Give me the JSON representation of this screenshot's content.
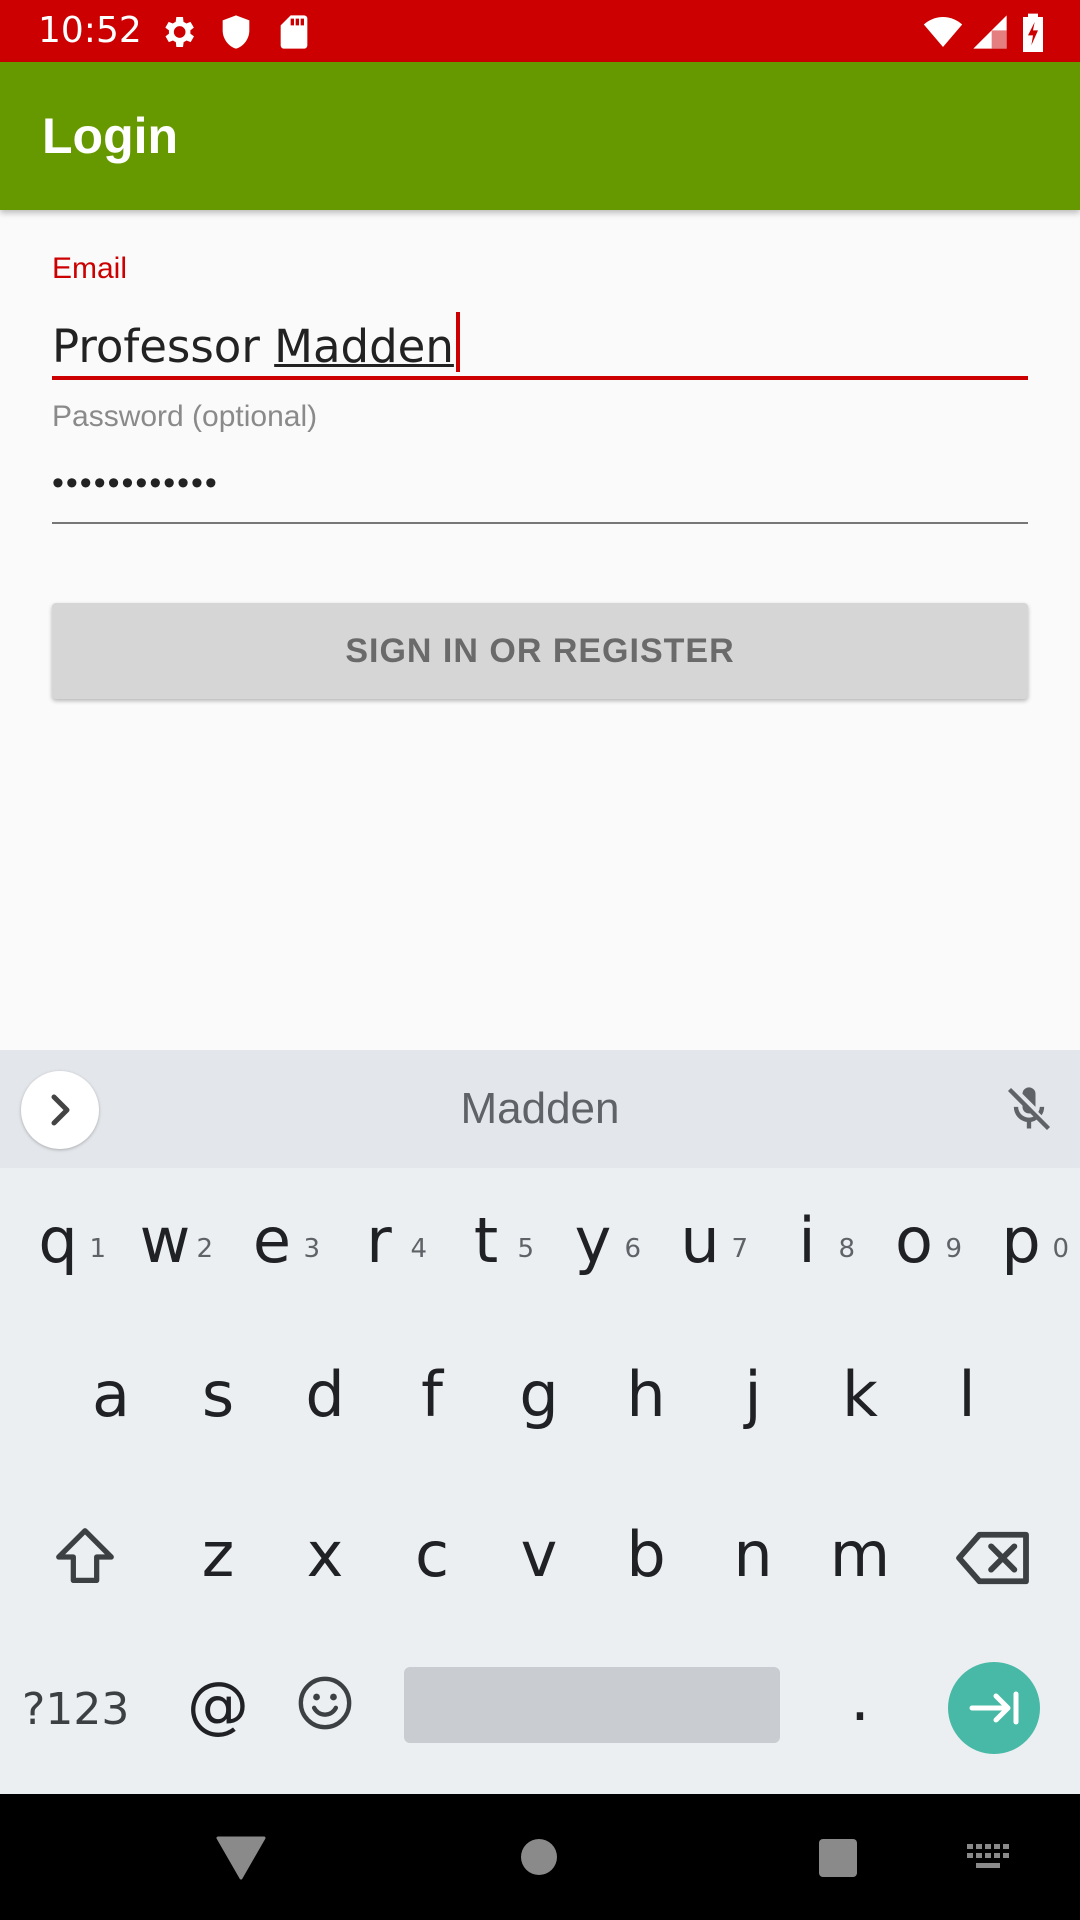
{
  "status_bar": {
    "time": "10:52",
    "left_icons": [
      "gear-icon",
      "shield-icon",
      "sd-card-icon"
    ],
    "right_icons": [
      "wifi-icon",
      "signal-icon",
      "battery-charging-icon"
    ]
  },
  "app_bar": {
    "title": "Login"
  },
  "form": {
    "email": {
      "label": "Email",
      "value_prefix": "Professor ",
      "value_composing": "Madden"
    },
    "password": {
      "label": "Password (optional)",
      "value": "••••••••••••"
    },
    "submit_label": "SIGN IN OR REGISTER"
  },
  "keyboard": {
    "suggestion": "Madden",
    "row1": [
      {
        "key": "q",
        "hint": "1"
      },
      {
        "key": "w",
        "hint": "2"
      },
      {
        "key": "e",
        "hint": "3"
      },
      {
        "key": "r",
        "hint": "4"
      },
      {
        "key": "t",
        "hint": "5"
      },
      {
        "key": "y",
        "hint": "6"
      },
      {
        "key": "u",
        "hint": "7"
      },
      {
        "key": "i",
        "hint": "8"
      },
      {
        "key": "o",
        "hint": "9"
      },
      {
        "key": "p",
        "hint": "0"
      }
    ],
    "row2": [
      "a",
      "s",
      "d",
      "f",
      "g",
      "h",
      "j",
      "k",
      "l"
    ],
    "row3": [
      "z",
      "x",
      "c",
      "v",
      "b",
      "n",
      "m"
    ],
    "symbols_label": "?123",
    "at_label": "@",
    "period_label": "."
  },
  "colors": {
    "status_bar": "#cc0000",
    "app_bar": "#669900",
    "accent": "#cc0000",
    "enter_key": "#48b9a6"
  }
}
